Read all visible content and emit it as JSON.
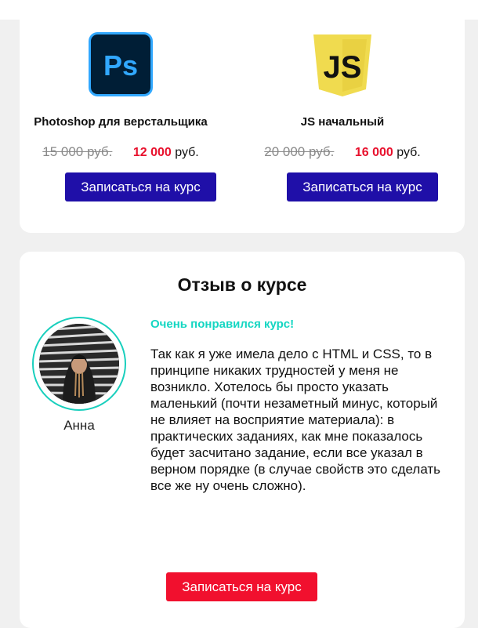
{
  "courses": [
    {
      "logo_text": "Ps",
      "logo_icon": "photoshop-icon",
      "title": "Photoshop для верстальщика",
      "old_price": "15 000 руб.",
      "new_price": "12 000",
      "currency": "руб.",
      "button_label": "Записаться на курс"
    },
    {
      "logo_text": "JS",
      "logo_icon": "javascript-icon",
      "title": "JS начальный",
      "old_price": "20 000 руб.",
      "new_price": "16 000",
      "currency": "руб.",
      "button_label": "Записаться на курс"
    }
  ],
  "review": {
    "heading": "Отзыв о курсе",
    "reviewer_name": "Анна",
    "tagline": "Очень понравился курс!",
    "text": "Так как я уже имела дело с HTML и CSS, то в принципе никаких трудностей у меня не возникло. Хотелось бы просто указать маленький (почти незаметный минус, который не влияет на восприятие материала): в практических заданиях, как мне показалось будет засчитано задание, если все указал в верном порядке (в случае свойств это сделать все же ну очень сложно).",
    "button_label": "Записаться на курс"
  },
  "colors": {
    "primary_button": "#1f0fa8",
    "accent_red": "#e8112d",
    "accent_teal": "#14d6c2",
    "ps_blue": "#31a8ff",
    "ps_bg": "#001e36",
    "js_yellow": "#f0db4f"
  }
}
